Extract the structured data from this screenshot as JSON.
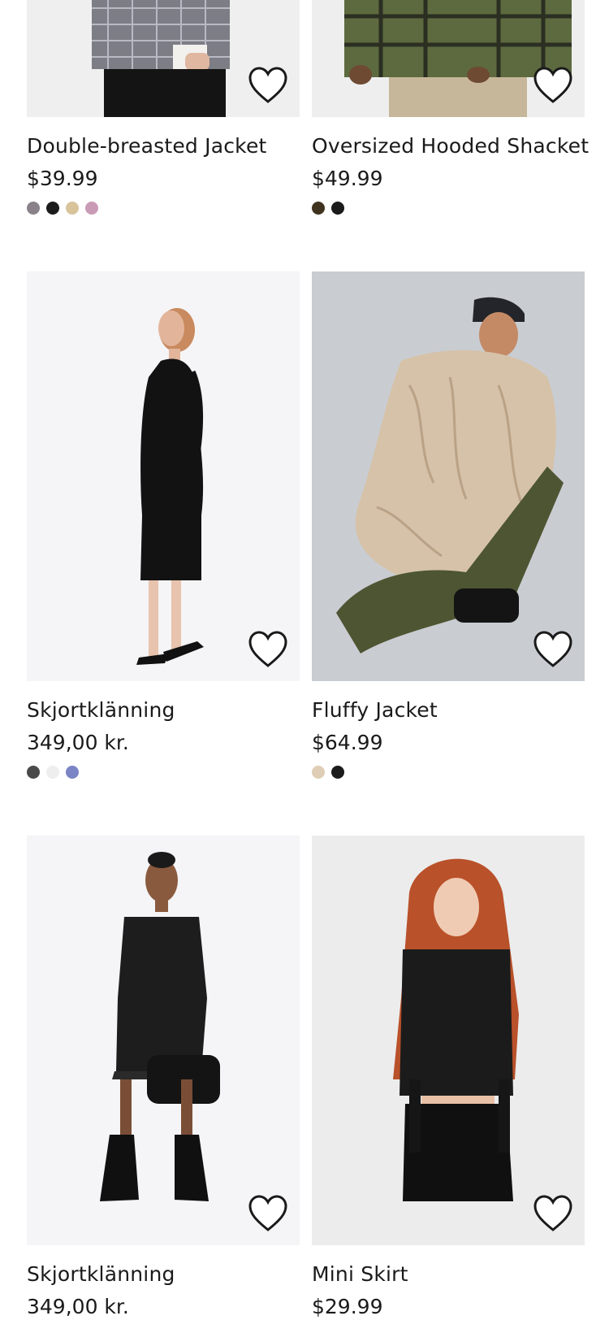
{
  "products": [
    {
      "title": "Double-breasted Jacket",
      "price": "$39.99",
      "swatches": [
        "#8a8288",
        "#1c1c1c",
        "#d9c39b",
        "#c99bb5"
      ]
    },
    {
      "title": "Oversized Hooded Shacket",
      "price": "$49.99",
      "swatches": [
        "#3f3320",
        "#1b1b1b"
      ]
    },
    {
      "title": "Skjortklänning",
      "price": "349,00 kr.",
      "swatches": [
        "#4a4a4a",
        "#eeeeee",
        "#7b84c4"
      ]
    },
    {
      "title": "Fluffy Jacket",
      "price": "$64.99",
      "swatches": [
        "#dfcdb5",
        "#1b1b1b"
      ]
    },
    {
      "title": "Skjortklänning",
      "price": "349,00 kr.",
      "swatches": []
    },
    {
      "title": "Mini Skirt",
      "price": "$29.99",
      "swatches": []
    }
  ],
  "icons": {
    "favorite": "heart-outline-icon"
  }
}
